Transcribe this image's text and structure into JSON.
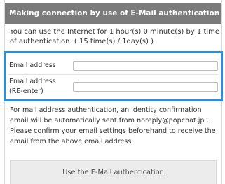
{
  "panel": {
    "title": "Making connection by use of E-Mail authentication"
  },
  "intro": {
    "text": "You can use the Internet for 1 hour(s) 0 minute(s) by 1 time of authentication. ( 15 time(s) / 1day(s) )"
  },
  "form": {
    "email_label": "Email address",
    "email_value": "",
    "email_confirm_label_line1": "Email address",
    "email_confirm_label_line2": "(RE-enter)",
    "email_confirm_value": ""
  },
  "note": {
    "text": "For mail address authentication, an identity confirmation email will be automatically sent from noreply@popchat.jp . Please confirm your email settings beforehand to receive the email from the above email address."
  },
  "actions": {
    "auth_button_label": "Use the E-Mail authentication"
  },
  "colors": {
    "header_bg": "#7b7b7b",
    "highlight_border": "#2a8ee0",
    "button_bg": "#ececec"
  }
}
